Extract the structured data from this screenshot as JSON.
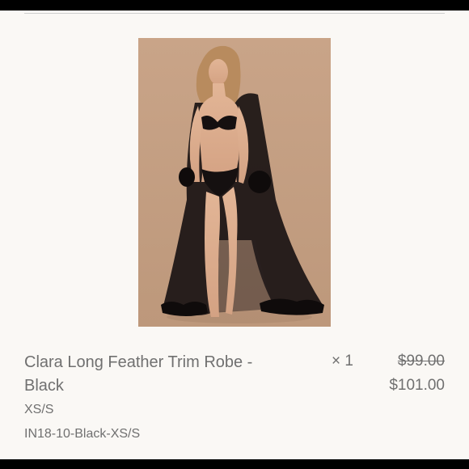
{
  "cart_item": {
    "title": "Clara Long Feather Trim Robe - Black",
    "quantity": "× 1",
    "original_price": "$99.00",
    "current_price": "$101.00",
    "variant": "XS/S",
    "sku": "IN18-10-Black-XS/S"
  },
  "colors": {
    "background": "#faf8f5",
    "text": "#707070",
    "image_backdrop": "#c6a184"
  }
}
